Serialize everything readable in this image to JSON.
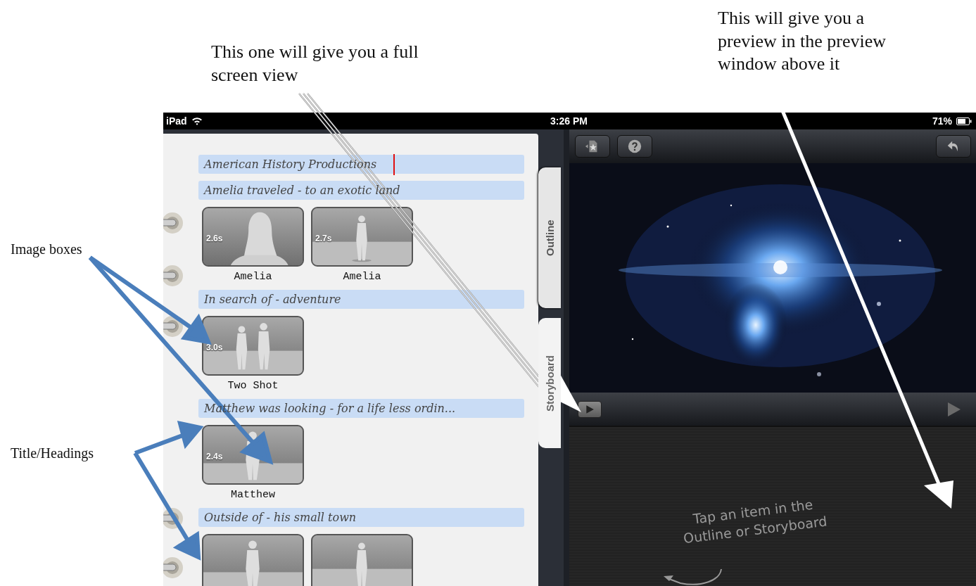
{
  "annotations": [
    {
      "kind": "top",
      "lines": [
        "This one will give you a full",
        "screen view"
      ]
    },
    {
      "kind": "top",
      "lines": [
        "This will give you a",
        "preview in the preview",
        "window above it"
      ]
    },
    {
      "kind": "side",
      "lines": [
        "Image boxes"
      ]
    },
    {
      "kind": "side",
      "lines": [
        "Title/Headings"
      ]
    }
  ],
  "status_bar": {
    "device": "iPad",
    "time": "3:26 PM",
    "battery": "71%"
  },
  "tabs": [
    {
      "label": "Outline",
      "selected": true
    },
    {
      "label": "Storyboard",
      "selected": false
    }
  ],
  "outline": [
    {
      "heading": "American History Productions",
      "cursor": true
    },
    {
      "heading": "Amelia traveled - to an exotic land",
      "cursor": false,
      "shots": [
        {
          "kind": "closeup",
          "duration": "2.6s",
          "name": "Amelia"
        },
        {
          "kind": "full",
          "duration": "2.7s",
          "name": "Amelia"
        }
      ]
    },
    {
      "heading": "In search of - adventure",
      "cursor": false,
      "shots": [
        {
          "kind": "two",
          "duration": "3.0s",
          "name": "Two Shot"
        }
      ]
    },
    {
      "heading": "Matthew was looking - for a life less ordin...",
      "cursor": false,
      "shots": [
        {
          "kind": "medium",
          "duration": "2.4s",
          "name": "Matthew"
        }
      ]
    },
    {
      "heading": "Outside of - his small town",
      "cursor": false,
      "shots": [
        {
          "kind": "medium"
        },
        {
          "kind": "full"
        }
      ]
    }
  ],
  "preview": {
    "hint_lines": [
      "Tap an item in the",
      "Outline or Storyboard"
    ]
  }
}
